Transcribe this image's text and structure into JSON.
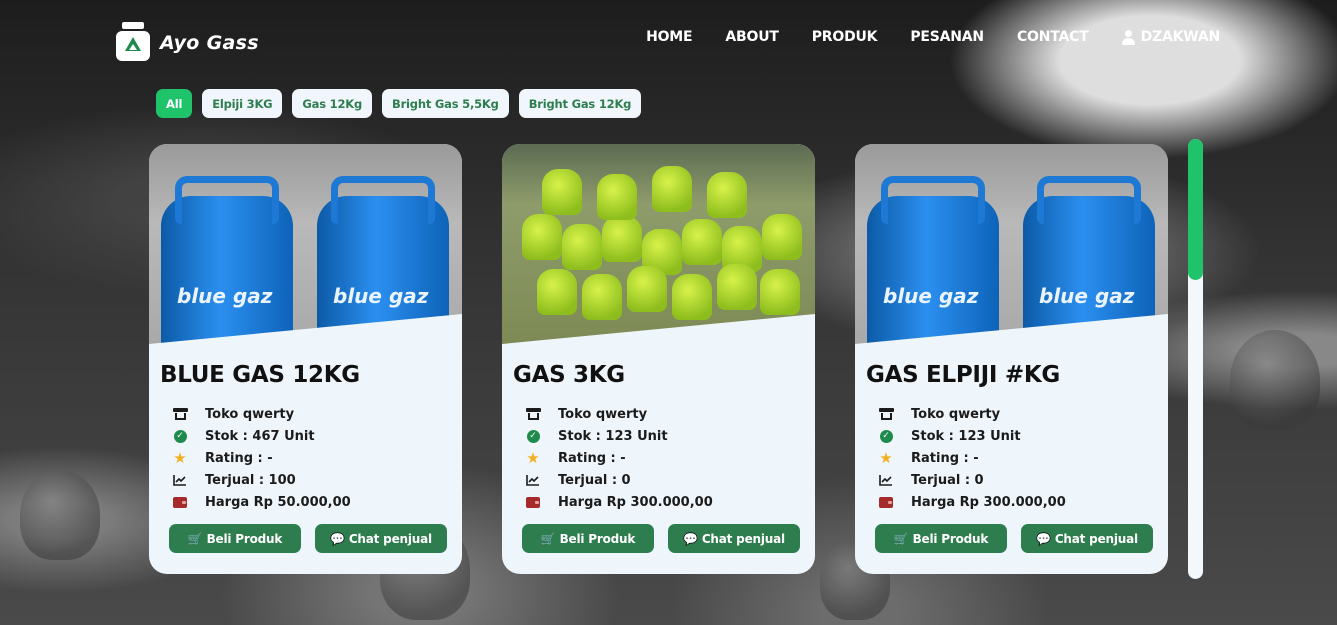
{
  "brand": {
    "name": "Ayo Gass"
  },
  "nav": {
    "items": [
      "HOME",
      "ABOUT",
      "PRODUK",
      "PESANAN",
      "CONTACT"
    ],
    "user": "DZAKWAN"
  },
  "filters": [
    {
      "label": "All",
      "active": true
    },
    {
      "label": "Elpiji 3KG",
      "active": false
    },
    {
      "label": "Gas 12Kg",
      "active": false
    },
    {
      "label": "Bright Gas 5,5Kg",
      "active": false
    },
    {
      "label": "Bright Gas 12Kg",
      "active": false
    }
  ],
  "products": [
    {
      "title": "BLUE GAS 12KG",
      "image": "blue-gas-cylinders",
      "store": "Toko qwerty",
      "stock": "Stok : 467 Unit",
      "rating": "Rating : -",
      "sold": "Terjual : 100",
      "price": "Harga Rp 50.000,00",
      "buy_label": "Beli Produk",
      "chat_label": "Chat penjual"
    },
    {
      "title": "GAS 3KG",
      "image": "green-3kg-cylinders",
      "store": "Toko qwerty",
      "stock": "Stok : 123 Unit",
      "rating": "Rating : -",
      "sold": "Terjual : 0",
      "price": "Harga Rp 300.000,00",
      "buy_label": "Beli Produk",
      "chat_label": "Chat penjual"
    },
    {
      "title": "GAS ELPIJI #KG",
      "image": "blue-gas-cylinders",
      "store": "Toko qwerty",
      "stock": "Stok : 123 Unit",
      "rating": "Rating : -",
      "sold": "Terjual : 0",
      "price": "Harga Rp 300.000,00",
      "buy_label": "Beli Produk",
      "chat_label": "Chat penjual"
    }
  ],
  "icons": {
    "store": "store-icon",
    "stock": "check-circle-icon",
    "rating": "star-icon",
    "sold": "chart-line-icon",
    "price": "wallet-icon",
    "buy": "cart-icon",
    "chat": "comment-icon"
  },
  "colors": {
    "accent": "#1fc46a",
    "button": "#2e7d4f",
    "card": "#eef6fc",
    "star": "#f2b01e",
    "wallet": "#a52a2a"
  },
  "scroll": {
    "position_fraction": 0.0,
    "visible_fraction": 0.32
  }
}
